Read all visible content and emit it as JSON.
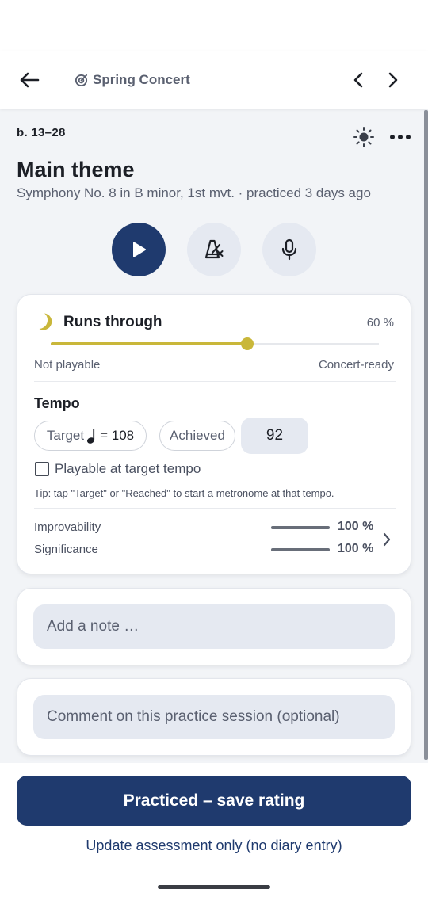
{
  "header": {
    "breadcrumb": "Spring Concert"
  },
  "piece": {
    "bars": "b. 13–28",
    "title": "Main theme",
    "subtitle": "Symphony No. 8 in B minor, 1st mvt. · practiced 3 days ago"
  },
  "rating": {
    "label": "Runs through",
    "percent_label": "60 %",
    "value": 0.6,
    "scale_min_label": "Not playable",
    "scale_max_label": "Concert-ready",
    "accent_color": "#c9b73a"
  },
  "tempo": {
    "heading": "Tempo",
    "target_prefix": "Target",
    "target_value": "= 108",
    "achieved_label": "Achieved",
    "achieved_value": "92",
    "checkbox_label": "Playable at target tempo",
    "checkbox_checked": false,
    "tip": "Tip: tap \"Target\" or \"Reached\" to start a metronome at that tempo."
  },
  "metrics": [
    {
      "label": "Improvability",
      "value_label": "100 %",
      "value": 1.0
    },
    {
      "label": "Significance",
      "value_label": "100 %",
      "value": 1.0
    }
  ],
  "note": {
    "placeholder": "Add a note …"
  },
  "comment": {
    "placeholder": "Comment on this practice session (optional)"
  },
  "actions": {
    "primary": "Practiced – save rating",
    "secondary": "Update assessment only (no diary entry)"
  },
  "colors": {
    "primary": "#1f3a6e",
    "accent": "#c9b73a"
  }
}
